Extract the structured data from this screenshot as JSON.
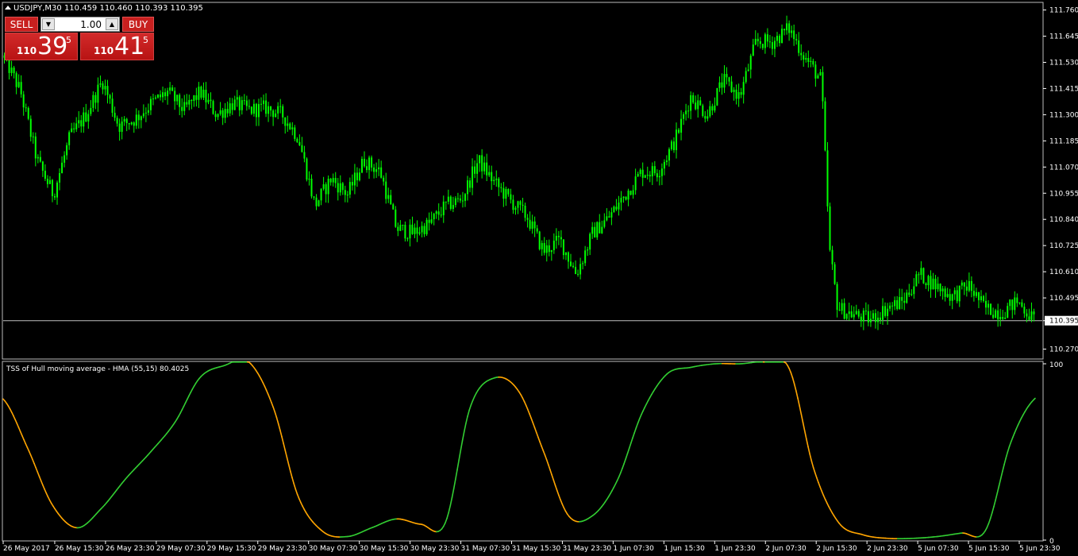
{
  "symbol_header": "USDJPY,M30  110.459 110.460 110.393 110.395",
  "trade_panel": {
    "sell_label": "SELL",
    "buy_label": "BUY",
    "lot_size": "1.00",
    "sell_price": {
      "prefix": "110",
      "big": "39",
      "sup": "5"
    },
    "buy_price": {
      "prefix": "110",
      "big": "41",
      "sup": "5"
    }
  },
  "indicator_title": "TSS of Hull moving average - HMA (55,15) 80.4025",
  "current_price_label": "110.395",
  "colors": {
    "background": "#000000",
    "candles": "#00ff00",
    "axis": "#ffffff",
    "price_line": "#c0c0c0",
    "indicator_rising": "#32cd32",
    "indicator_falling": "#ffa500",
    "button_red": "#c8201f"
  },
  "chart_data": [
    {
      "type": "candlestick",
      "series": [
        {
          "name": "USDJPY,M30"
        }
      ],
      "ylim": [
        110.23,
        111.79
      ],
      "y_ticks": [
        "111.760",
        "111.645",
        "111.530",
        "111.415",
        "111.300",
        "111.185",
        "111.070",
        "110.955",
        "110.840",
        "110.725",
        "110.610",
        "110.495",
        "110.395",
        "110.270"
      ],
      "x_ticks": [
        "26 May 2017",
        "26 May 15:30",
        "26 May 23:30",
        "29 May 07:30",
        "29 May 15:30",
        "29 May 23:30",
        "30 May 07:30",
        "30 May 15:30",
        "30 May 23:30",
        "31 May 07:30",
        "31 May 15:30",
        "31 May 23:30",
        "1 Jun 07:30",
        "1 Jun 15:30",
        "1 Jun 23:30",
        "2 Jun 07:30",
        "2 Jun 15:30",
        "2 Jun 23:30",
        "5 Jun 07:30",
        "5 Jun 15:30",
        "5 Jun 23:30"
      ],
      "close_path": [
        [
          0,
          111.55
        ],
        [
          2,
          111.4
        ],
        [
          4,
          111.1
        ],
        [
          6,
          110.95
        ],
        [
          8,
          111.2
        ],
        [
          10,
          111.3
        ],
        [
          12,
          111.45
        ],
        [
          14,
          111.25
        ],
        [
          16,
          111.28
        ],
        [
          18,
          111.35
        ],
        [
          20,
          111.4
        ],
        [
          22,
          111.32
        ],
        [
          24,
          111.4
        ],
        [
          26,
          111.3
        ],
        [
          28,
          111.35
        ],
        [
          30,
          111.32
        ],
        [
          32,
          111.33
        ],
        [
          34,
          111.3
        ],
        [
          36,
          111.2
        ],
        [
          38,
          110.9
        ],
        [
          40,
          111.02
        ],
        [
          42,
          110.95
        ],
        [
          44,
          111.1
        ],
        [
          46,
          111.05
        ],
        [
          48,
          110.8
        ],
        [
          50,
          110.78
        ],
        [
          52,
          110.82
        ],
        [
          54,
          110.9
        ],
        [
          56,
          110.93
        ],
        [
          58,
          111.1
        ],
        [
          60,
          111.0
        ],
        [
          62,
          110.92
        ],
        [
          64,
          110.85
        ],
        [
          66,
          110.7
        ],
        [
          68,
          110.75
        ],
        [
          70,
          110.6
        ],
        [
          72,
          110.78
        ],
        [
          74,
          110.85
        ],
        [
          76,
          110.95
        ],
        [
          78,
          111.05
        ],
        [
          80,
          111.05
        ],
        [
          82,
          111.18
        ],
        [
          84,
          111.38
        ],
        [
          86,
          111.3
        ],
        [
          88,
          111.45
        ],
        [
          90,
          111.38
        ],
        [
          92,
          111.62
        ],
        [
          94,
          111.62
        ],
        [
          96,
          111.68
        ],
        [
          98,
          111.55
        ],
        [
          100,
          111.45
        ],
        [
          101,
          110.7
        ],
        [
          102,
          110.45
        ],
        [
          104,
          110.42
        ],
        [
          106,
          110.4
        ],
        [
          108,
          110.45
        ],
        [
          110,
          110.48
        ],
        [
          112,
          110.6
        ],
        [
          114,
          110.55
        ],
        [
          116,
          110.5
        ],
        [
          118,
          110.55
        ],
        [
          120,
          110.45
        ],
        [
          122,
          110.43
        ],
        [
          124,
          110.48
        ],
        [
          126,
          110.4
        ]
      ],
      "current_price": 110.395
    },
    {
      "type": "line",
      "series": [
        {
          "name": "TSS of Hull moving average - HMA (55,15)"
        }
      ],
      "ylim": [
        0,
        100
      ],
      "y_ticks": [
        "100",
        "0"
      ],
      "x": [
        0,
        3,
        6,
        9,
        12,
        15,
        18,
        21,
        24,
        27,
        30,
        33,
        36,
        39,
        42,
        45,
        48,
        51,
        54,
        57,
        60,
        63,
        66,
        69,
        72,
        75,
        78,
        81,
        84,
        87,
        90,
        93,
        96,
        99,
        102,
        105,
        108,
        111,
        114,
        117,
        120,
        123,
        126
      ],
      "values": [
        80.0,
        52.0,
        20.0,
        7.0,
        18.0,
        35.0,
        50.0,
        67.0,
        92.0,
        99.0,
        101.0,
        75.0,
        25.0,
        5.0,
        2.0,
        7.0,
        12.0,
        9.0,
        10.0,
        75.0,
        92.0,
        84.0,
        50.0,
        14.0,
        14.0,
        34.0,
        72.0,
        94.0,
        98.0,
        100.0,
        100.0,
        101.0,
        97.0,
        40.0,
        10.0,
        3.0,
        1.0,
        1.0,
        2.0,
        4.0,
        6.0,
        55.0,
        80.4025
      ],
      "rising_color": "#32cd32",
      "falling_color": "#ffa500",
      "last_value": 80.4025
    }
  ]
}
